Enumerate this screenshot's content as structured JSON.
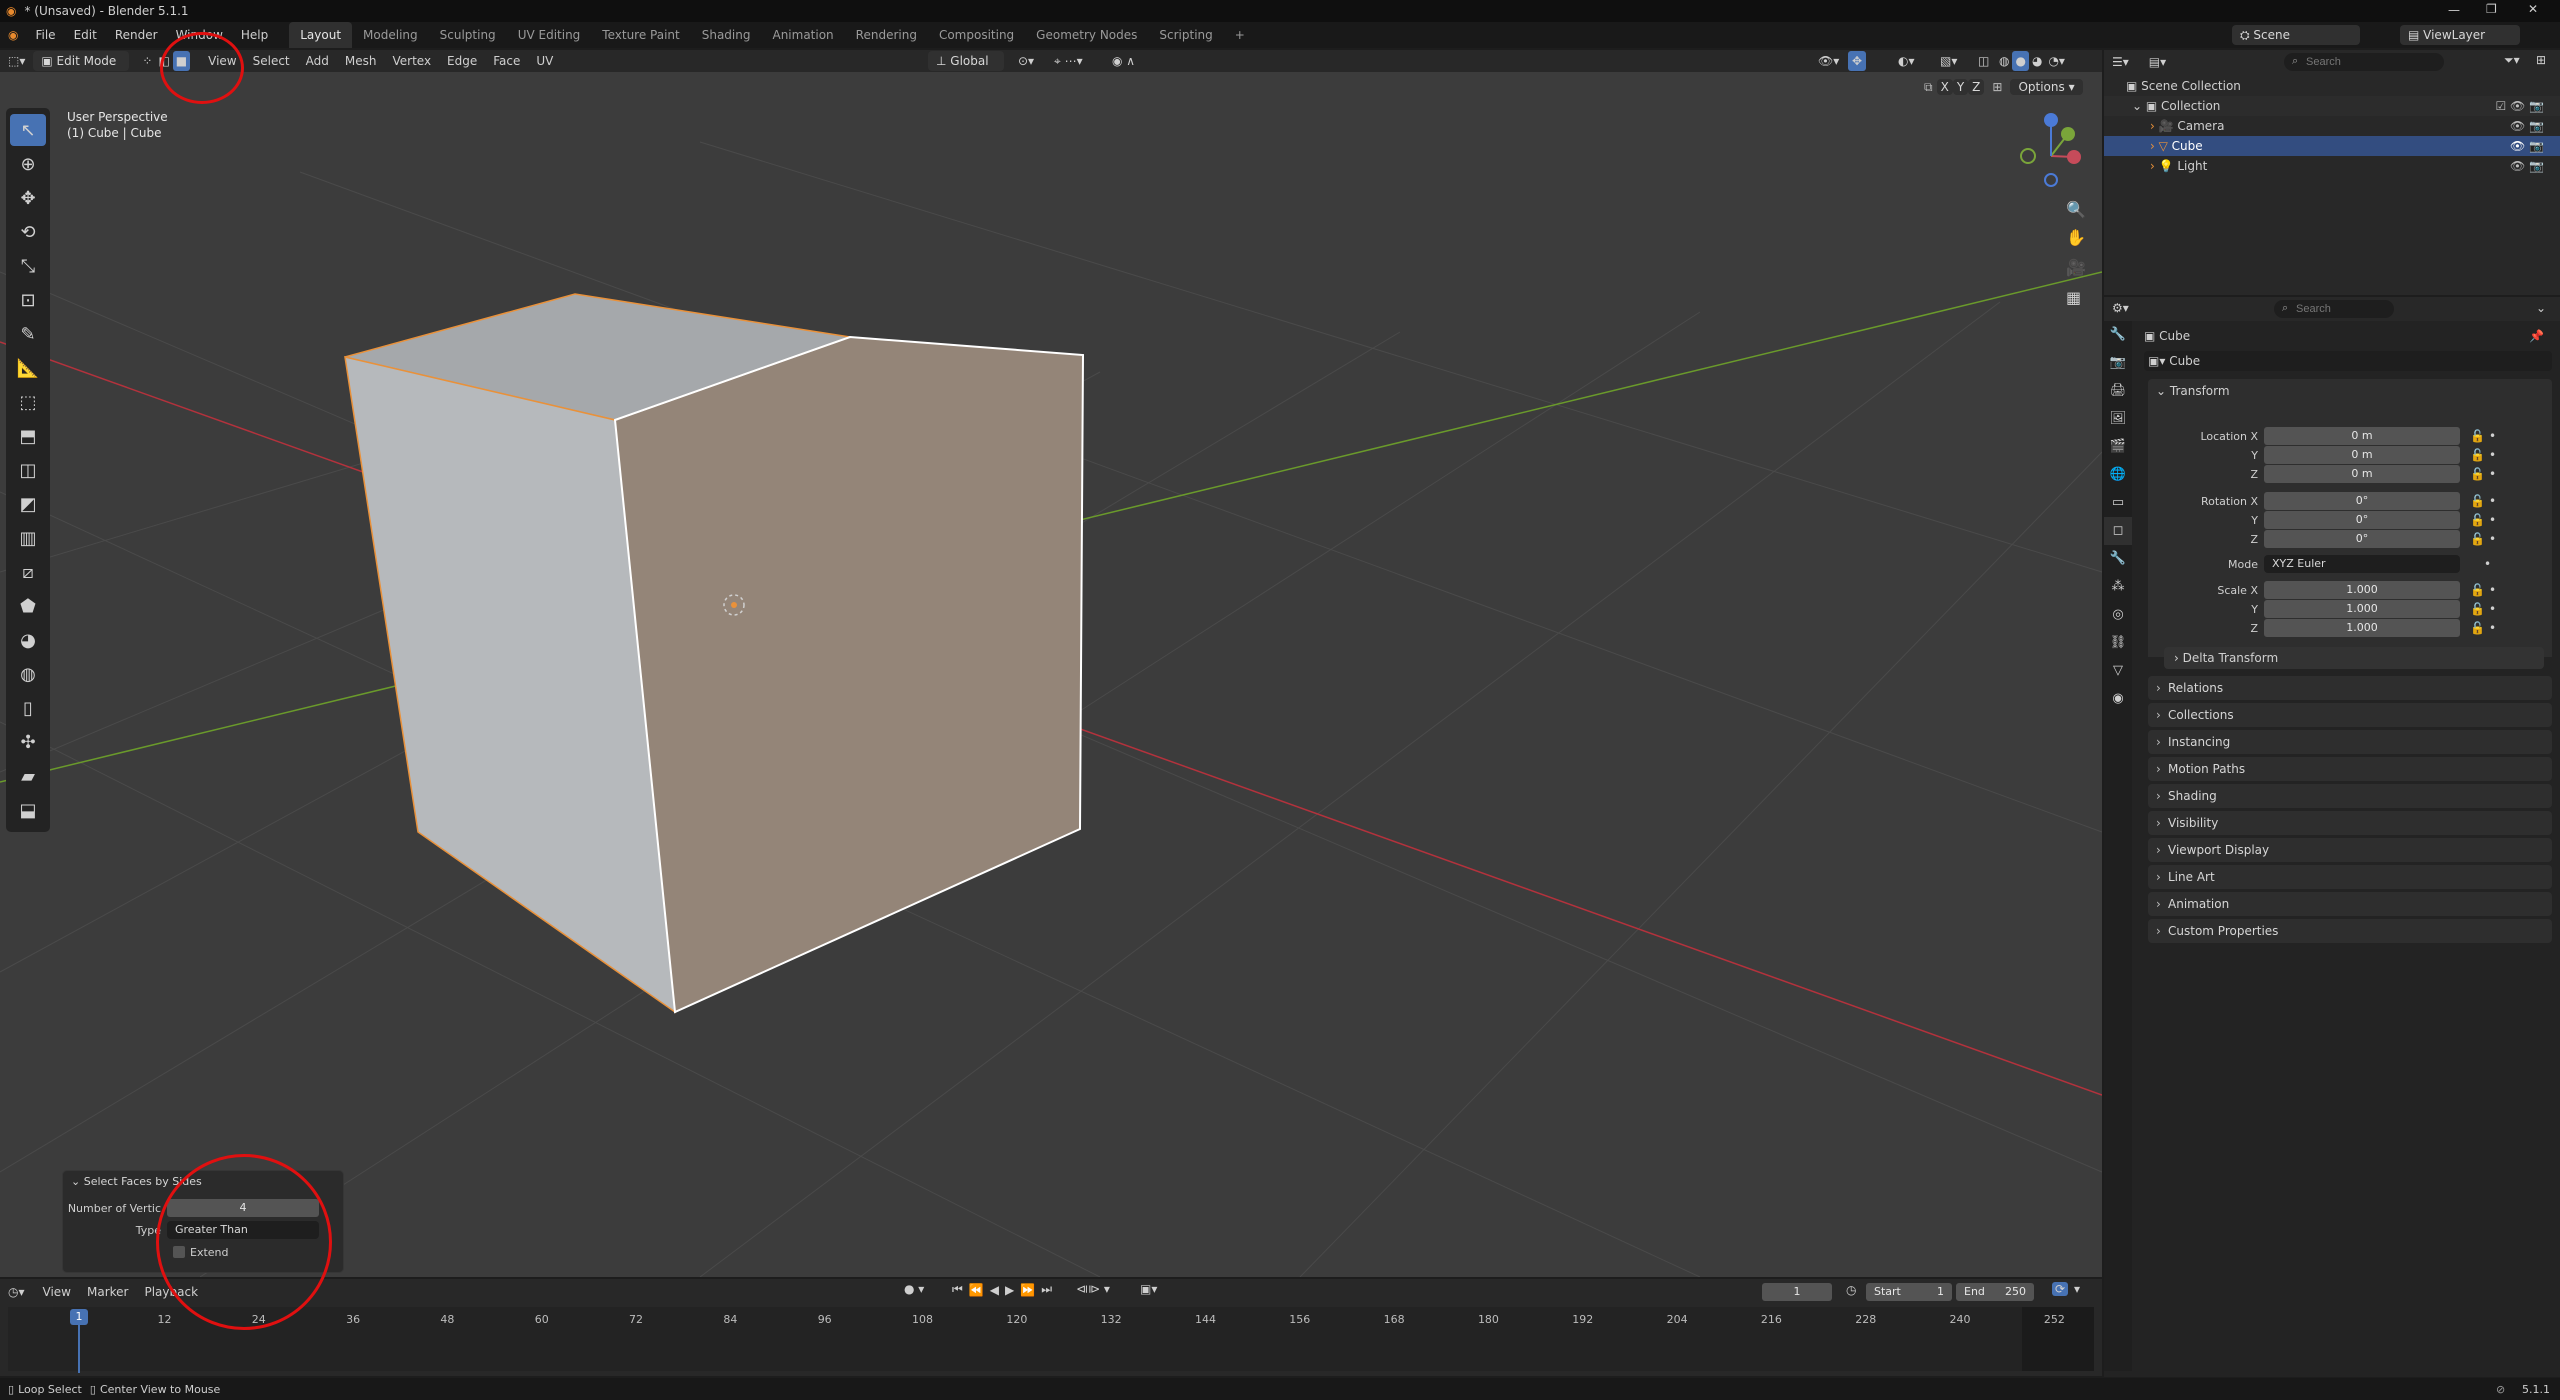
{
  "title": "* (Unsaved) - Blender 5.1.1",
  "menus": [
    "File",
    "Edit",
    "Render",
    "Window",
    "Help"
  ],
  "workspaces": [
    "Layout",
    "Modeling",
    "Sculpting",
    "UV Editing",
    "Texture Paint",
    "Shading",
    "Animation",
    "Rendering",
    "Compositing",
    "Geometry Nodes",
    "Scripting",
    "+"
  ],
  "scene": "Scene",
  "view_layer": "ViewLayer",
  "header": {
    "mode": "Edit Mode",
    "menus": [
      "View",
      "Select",
      "Add",
      "Mesh",
      "Vertex",
      "Edge",
      "Face",
      "UV"
    ],
    "orientation": "Global",
    "options": "Options",
    "axes": [
      "X",
      "Y",
      "Z"
    ]
  },
  "viewport": {
    "line1": "User Perspective",
    "line2": "(1) Cube | Cube"
  },
  "outliner": {
    "search_placeholder": "Search",
    "root": "Scene Collection",
    "collection": "Collection",
    "items": [
      "Camera",
      "Cube",
      "Light"
    ]
  },
  "props": {
    "search_placeholder": "Search",
    "object_name": "Cube",
    "data_name": "Cube",
    "transform_title": "Transform",
    "location_label": "Location X",
    "location": [
      "0 m",
      "0 m",
      "0 m"
    ],
    "rotation_label": "Rotation X",
    "rotation": [
      "0°",
      "0°",
      "0°"
    ],
    "mode_label": "Mode",
    "mode": "XYZ Euler",
    "scale_label": "Scale X",
    "scale": [
      "1.000",
      "1.000",
      "1.000"
    ],
    "y": "Y",
    "z": "Z",
    "delta": "Delta Transform",
    "panels": [
      "Relations",
      "Collections",
      "Instancing",
      "Motion Paths",
      "Shading",
      "Visibility",
      "Viewport Display",
      "Line Art",
      "Animation",
      "Custom Properties"
    ]
  },
  "operator": {
    "title": "Select Faces by Sides",
    "verts_label": "Number of Vertic",
    "verts": "4",
    "type_label": "Type",
    "type": "Greater Than",
    "extend": "Extend"
  },
  "timeline": {
    "menus": [
      "View",
      "Marker",
      "Playback"
    ],
    "current": "1",
    "start_label": "Start",
    "start": "1",
    "end_label": "End",
    "end": "250",
    "ticks": [
      "1",
      "12",
      "24",
      "36",
      "48",
      "60",
      "72",
      "84",
      "96",
      "108",
      "120",
      "132",
      "144",
      "156",
      "168",
      "180",
      "192",
      "204",
      "216",
      "228",
      "240",
      "252"
    ]
  },
  "status": {
    "left1": "Loop Select",
    "left2": "Center View to Mouse",
    "version": "5.1.1"
  }
}
